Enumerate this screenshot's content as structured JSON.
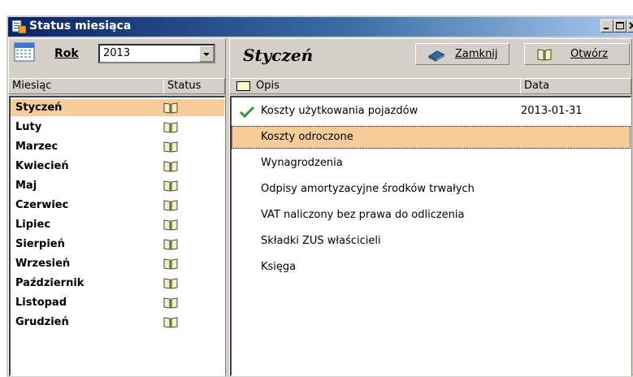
{
  "window": {
    "title": "Status miesiąca"
  },
  "year": {
    "label": "Rok",
    "value": "2013"
  },
  "months_list": {
    "headers": {
      "month": "Miesiąc",
      "status": "Status"
    },
    "selected_index": 0,
    "items": [
      {
        "name": "Styczeń"
      },
      {
        "name": "Luty"
      },
      {
        "name": "Marzec"
      },
      {
        "name": "Kwiecień"
      },
      {
        "name": "Maj"
      },
      {
        "name": "Czerwiec"
      },
      {
        "name": "Lipiec"
      },
      {
        "name": "Sierpień"
      },
      {
        "name": "Wrzesień"
      },
      {
        "name": "Październik"
      },
      {
        "name": "Listopad"
      },
      {
        "name": "Grudzień"
      }
    ]
  },
  "detail": {
    "month_title": "Styczeń",
    "close_button": "Zamknij",
    "open_button": "Otwórz",
    "headers": {
      "opis": "Opis",
      "data": "Data"
    },
    "selected_index": 1,
    "items": [
      {
        "opis": "Koszty użytkowania pojazdów",
        "data": "2013-01-31",
        "checked": true
      },
      {
        "opis": "Koszty odroczone",
        "data": "",
        "checked": false
      },
      {
        "opis": "Wynagrodzenia",
        "data": "",
        "checked": false
      },
      {
        "opis": "Odpisy amortyzacyjne środków trwałych",
        "data": "",
        "checked": false
      },
      {
        "opis": "VAT naliczony bez prawa do odliczenia",
        "data": "",
        "checked": false
      },
      {
        "opis": "Składki ZUS właścicieli",
        "data": "",
        "checked": false
      },
      {
        "opis": "Księga",
        "data": "",
        "checked": false
      }
    ]
  },
  "colors": {
    "selection": "#f8cc98",
    "titlebar": "#0a246a",
    "check": "#2e9a2e"
  },
  "icons": {
    "title": "window-app-icon",
    "calendar": "calendar-icon",
    "book": "open-book-icon",
    "close": "book-close-icon",
    "open": "book-open-icon",
    "check": "checkmark-icon"
  }
}
